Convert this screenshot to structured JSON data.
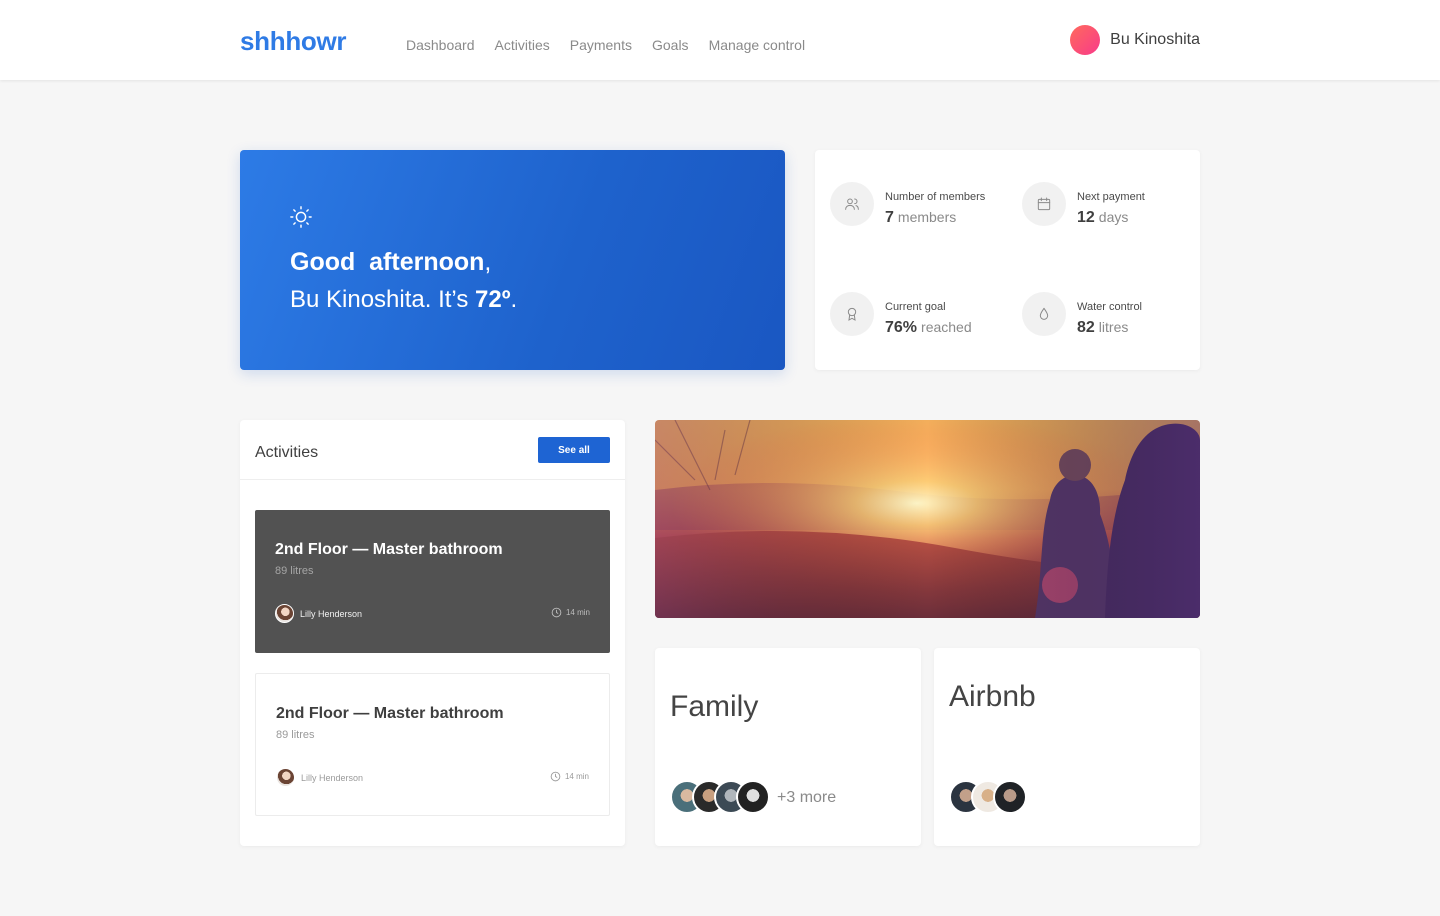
{
  "app": {
    "logo": "shhhowr"
  },
  "nav": [
    "Dashboard",
    "Activities",
    "Payments",
    "Goals",
    "Manage control"
  ],
  "user": {
    "name": "Bu Kinoshita"
  },
  "hero": {
    "greeting": "Good  afternoon",
    "greeting_comma": ",",
    "line2_prefix": "Bu Kinoshita. It’s ",
    "temperature": "72º",
    "line2_suffix": "."
  },
  "stats": [
    {
      "label": "Number of members",
      "value": "7",
      "unit": "members",
      "icon": "members-icon"
    },
    {
      "label": "Next payment",
      "value": "12",
      "unit": "days",
      "icon": "calendar-icon"
    },
    {
      "label": "Current goal",
      "value": "76%",
      "unit": "reached",
      "icon": "award-icon"
    },
    {
      "label": "Water control",
      "value": "82",
      "unit": "litres",
      "icon": "water-drop-icon"
    }
  ],
  "activities": {
    "title": "Activities",
    "see_all_label": "See all",
    "items": [
      {
        "title": "2nd Floor — Master bathroom",
        "subtitle": "89 litres",
        "person": "Lilly Henderson",
        "time": "14 min"
      },
      {
        "title": "2nd Floor — Master bathroom",
        "subtitle": "89 litres",
        "person": "Lilly Henderson",
        "time": "14 min"
      }
    ]
  },
  "groups": [
    {
      "title": "Family",
      "more": "+3 more"
    },
    {
      "title": "Airbnb"
    }
  ],
  "colors": {
    "brand": "#2f7be5",
    "primary_button": "#1e64d3"
  }
}
